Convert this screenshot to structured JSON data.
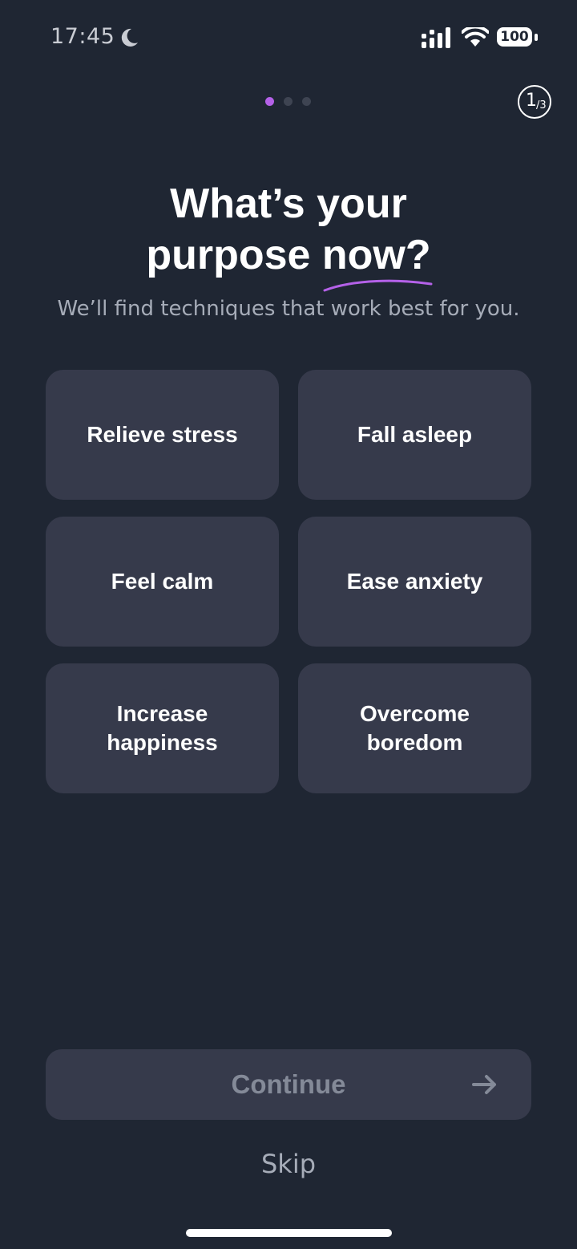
{
  "status_bar": {
    "time": "17:45",
    "battery": "100",
    "icons": [
      "moon-icon",
      "signal-icon",
      "wifi-icon",
      "battery-icon"
    ]
  },
  "progress": {
    "dots_total": 3,
    "active_index": 0,
    "step_current": "1",
    "step_total": "3"
  },
  "title": {
    "line1": "What’s your",
    "line2": "purpose now?"
  },
  "subtitle": "We’ll find techniques that work best for you.",
  "options": [
    "Relieve stress",
    "Fall asleep",
    "Feel calm",
    "Ease anxiety",
    "Increase happiness",
    "Overcome boredom"
  ],
  "continue_label": "Continue",
  "skip_label": "Skip",
  "colors": {
    "background": "#1f2633",
    "card": "#363a4b",
    "accent": "#b461e8",
    "muted_text": "#a6acb8"
  }
}
